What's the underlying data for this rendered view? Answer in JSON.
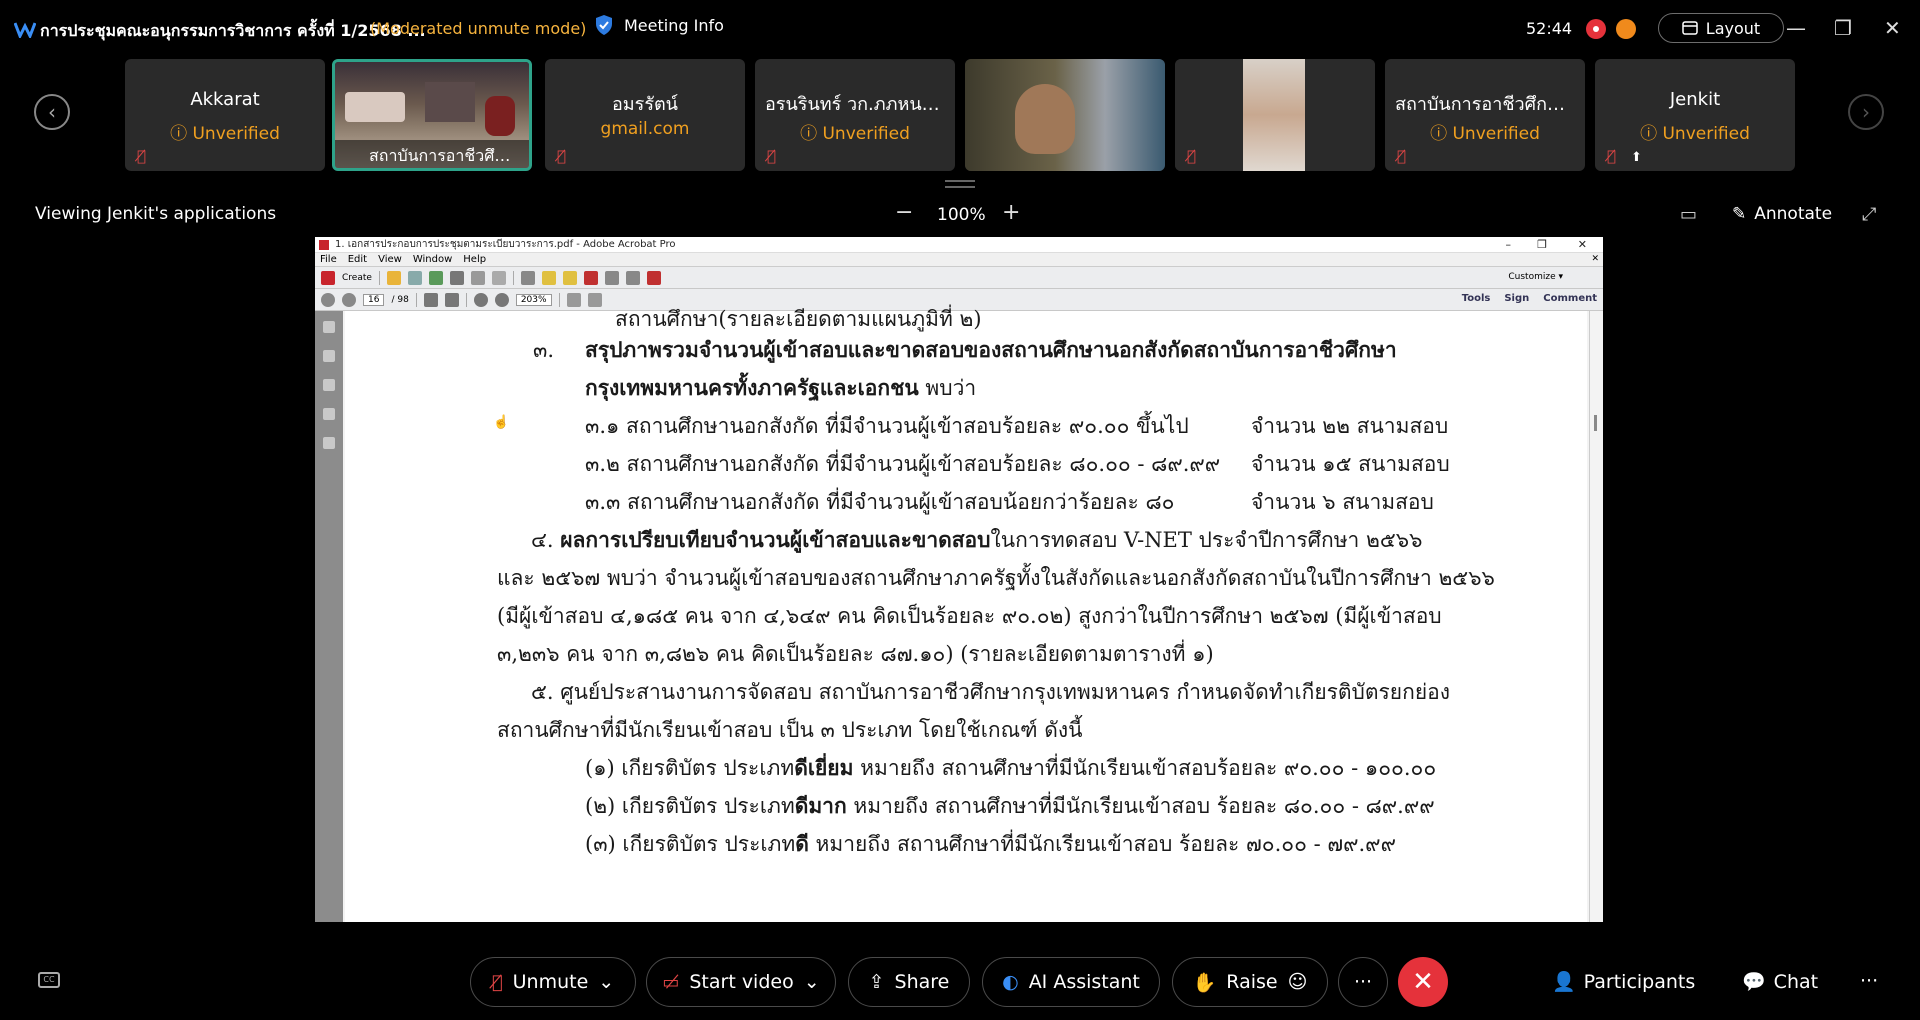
{
  "header": {
    "meeting_title": "การประชุมคณะอนุกรรมการวิชาการ ครั้งที่ 1/2568 ...",
    "mode": "(Moderated unmute mode)",
    "meeting_info": "Meeting Info",
    "timer": "52:44",
    "layout": "Layout"
  },
  "participants": [
    {
      "name": "Akkarat",
      "sub": "Unverified",
      "verified": false
    },
    {
      "name": "สถาบันการอาชีวศึก...",
      "video": true,
      "active": true
    },
    {
      "name": "อมรรัตน์",
      "sub": "gmail.com",
      "verified": true
    },
    {
      "name": "อรนรินทร์ วก.ภภหนองจ...",
      "sub": "Unverified",
      "verified": false
    },
    {
      "name": "",
      "video": true
    },
    {
      "name": "",
      "video": true
    },
    {
      "name": "สถาบันการอาชีวศึกษา...",
      "sub": "Unverified",
      "verified": false
    },
    {
      "name": "Jenkit",
      "sub": "Unverified",
      "verified": false
    }
  ],
  "view": {
    "viewing": "Viewing Jenkit's applications",
    "zoom": "100%",
    "annotate": "Annotate"
  },
  "acrobat": {
    "title": "1. เอกสารประกอบการประชุมตามระเบียบวาระการ.pdf - Adobe Acrobat Pro",
    "menu": [
      "File",
      "Edit",
      "View",
      "Window",
      "Help"
    ],
    "create": "Create",
    "page_num": "16",
    "page_total": "/ 98",
    "zoom": "203%",
    "customize": "Customize",
    "tools": "Tools",
    "sign": "Sign",
    "comment": "Comment"
  },
  "doc": {
    "l0": "สถานศึกษา(รายละเอียดตามแผนภูมิที่ ๒)",
    "l1a": "๓.",
    "l1b": "สรุปภาพรวมจำนวนผู้เข้าสอบและขาดสอบของสถานศึกษานอกสังกัดสถาบันการอาชีวศึกษา",
    "l2a": "กรุงเทพมหานครทั้งภาครัฐและเอกชน",
    "l2b": " พบว่า",
    "l3a": "๓.๑ สถานศึกษานอกสังกัด ที่มีจำนวนผู้เข้าสอบร้อยละ ๙๐.๐๐ ขึ้นไป",
    "l3b": "จำนวน ๒๒ สนามสอบ",
    "l4a": "๓.๒ สถานศึกษานอกสังกัด ที่มีจำนวนผู้เข้าสอบร้อยละ ๘๐.๐๐ - ๘๙.๙๙",
    "l4b": "จำนวน ๑๕ สนามสอบ",
    "l5a": "๓.๓ สถานศึกษานอกสังกัด ที่มีจำนวนผู้เข้าสอบน้อยกว่าร้อยละ ๘๐",
    "l5b": "จำนวน ๖ สนามสอบ",
    "l6a": "๔. ",
    "l6b": "ผลการเปรียบเทียบจำนวนผู้เข้าสอบและขาดสอบ",
    "l6c": "ในการทดสอบ V-NET ประจำปีการศึกษา ๒๕๖๖",
    "l7": "และ ๒๕๖๗ พบว่า จำนวนผู้เข้าสอบของสถานศึกษาภาครัฐทั้งในสังกัดและนอกสังกัดสถาบันในปีการศึกษา ๒๕๖๖",
    "l8": "(มีผู้เข้าสอบ ๔,๑๘๕ คน จาก ๔,๖๔๙ คน คิดเป็นร้อยละ ๙๐.๐๒) สูงกว่าในปีการศึกษา ๒๕๖๗ (มีผู้เข้าสอบ",
    "l9": "๓,๒๓๖ คน จาก ๓,๘๒๖ คน คิดเป็นร้อยละ ๘๗.๑๐) (รายละเอียดตามตารางที่ ๑)",
    "l10": "๕. ศูนย์ประสานงานการจัดสอบ สถาบันการอาชีวศึกษากรุงเทพมหานคร กำหนดจัดทำเกียรติบัตรยกย่อง",
    "l11": "สถานศึกษาที่มีนักเรียนเข้าสอบ เป็น ๓ ประเภท โดยใช้เกณฑ์ ดังนี้",
    "l12a": "(๑) เกียรติบัตร ประเภท",
    "l12b": "ดีเยี่ยม",
    "l12c": " หมายถึง สถานศึกษาที่มีนักเรียนเข้าสอบร้อยละ ๙๐.๐๐ - ๑๐๐.๐๐",
    "l13a": "(๒) เกียรติบัตร ประเภท",
    "l13b": "ดีมาก",
    "l13c": "  หมายถึง สถานศึกษาที่มีนักเรียนเข้าสอบ ร้อยละ ๘๐.๐๐ - ๘๙.๙๙",
    "l14a": "(๓) เกียรติบัตร ประเภท",
    "l14b": "ดี",
    "l14c": "  หมายถึง สถานศึกษาที่มีนักเรียนเข้าสอบ ร้อยละ ๗๐.๐๐ - ๗๙.๙๙"
  },
  "controls": {
    "unmute": "Unmute",
    "start_video": "Start video",
    "share": "Share",
    "ai": "AI Assistant",
    "raise": "Raise",
    "participants": "Participants",
    "chat": "Chat"
  },
  "colors": {
    "accent": "#2ea38a",
    "warning": "#f0a020",
    "danger": "#e5323b"
  }
}
